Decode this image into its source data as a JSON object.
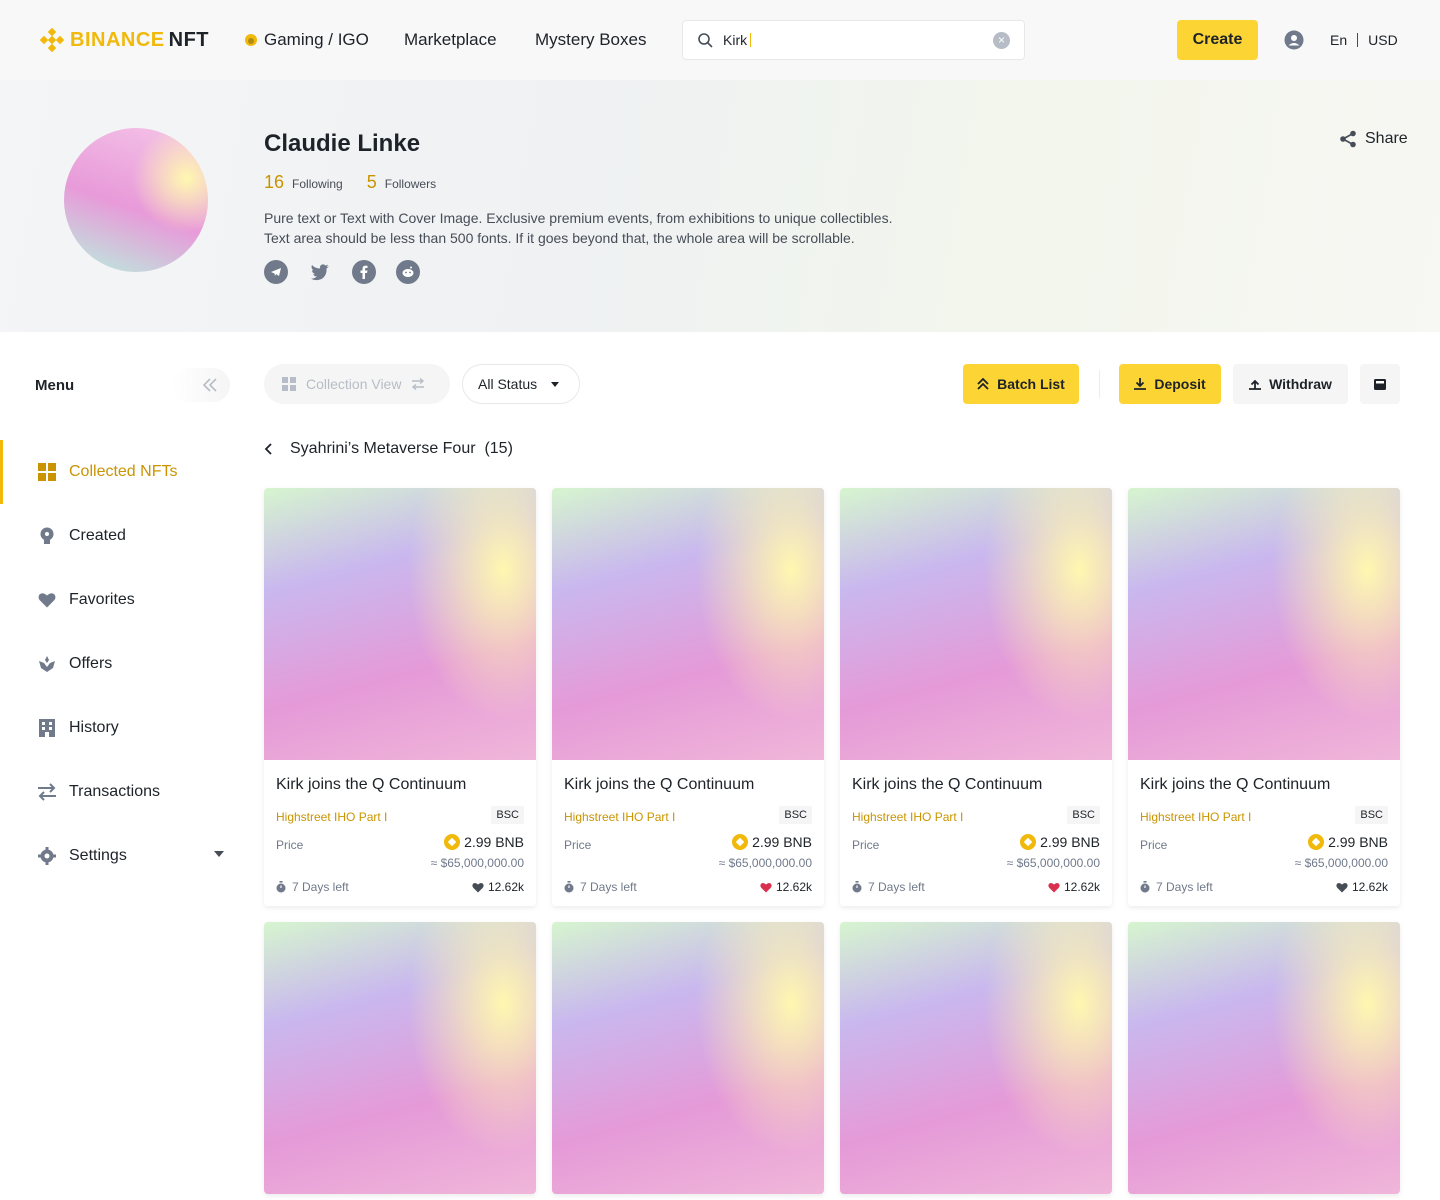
{
  "header": {
    "logo_main": "BINANCE",
    "logo_sub": "NFT",
    "nav": [
      "Gaming / IGO",
      "Marketplace",
      "Mystery Boxes"
    ],
    "search_value": "Kirk",
    "user_center": "User Center",
    "create_label": "Create",
    "language": "En",
    "currency": "USD"
  },
  "profile": {
    "name": "Claudie Linke",
    "following_count": "16",
    "following_label": "Following",
    "followers_count": "5",
    "followers_label": "Followers",
    "bio_line1": "Pure text or Text with Cover Image. Exclusive premium events, from exhibitions to unique collectibles.",
    "bio_line2": "Text area should be less than 500 fonts. If it goes beyond that, the whole area will be scrollable.",
    "share_label": "Share"
  },
  "sidebar": {
    "title": "Menu",
    "items": [
      {
        "label": "Collected NFTs",
        "icon": "grid-icon"
      },
      {
        "label": "Created",
        "icon": "bulb-icon"
      },
      {
        "label": "Favorites",
        "icon": "heart-icon"
      },
      {
        "label": "Offers",
        "icon": "hand-icon"
      },
      {
        "label": "History",
        "icon": "building-icon"
      },
      {
        "label": "Transactions",
        "icon": "swap-icon"
      },
      {
        "label": "Settings",
        "icon": "gear-icon"
      }
    ]
  },
  "toolbar": {
    "collection_view": "Collection View",
    "status": "All Status",
    "batch_list": "Batch List",
    "deposit": "Deposit",
    "withdraw": "Withdraw"
  },
  "breadcrumb": {
    "title": "Syahrini’s Metaverse Four",
    "count": "(15)"
  },
  "cards": [
    {
      "title": "Kirk joins the Q Continuum",
      "collection": "Highstreet IHO Part I",
      "chain": "BSC",
      "price_label": "Price",
      "price": "2.99 BNB",
      "usd": "≈ $65,000,000.00",
      "time_left": "7 Days left",
      "likes": "12.62k",
      "liked": false
    },
    {
      "title": "Kirk joins the Q Continuum",
      "collection": "Highstreet IHO Part I",
      "chain": "BSC",
      "price_label": "Price",
      "price": "2.99 BNB",
      "usd": "≈ $65,000,000.00",
      "time_left": "7 Days left",
      "likes": "12.62k",
      "liked": true
    },
    {
      "title": "Kirk joins the Q Continuum",
      "collection": "Highstreet IHO Part I",
      "chain": "BSC",
      "price_label": "Price",
      "price": "2.99 BNB",
      "usd": "≈ $65,000,000.00",
      "time_left": "7 Days left",
      "likes": "12.62k",
      "liked": true
    },
    {
      "title": "Kirk joins the Q Continuum",
      "collection": "Highstreet IHO Part I",
      "chain": "BSC",
      "price_label": "Price",
      "price": "2.99 BNB",
      "usd": "≈ $65,000,000.00",
      "time_left": "7 Days left",
      "likes": "12.62k",
      "liked": false
    }
  ],
  "colors": {
    "brand": "#F0B90B",
    "button_yellow": "#FCD535",
    "like_red": "#D9304E"
  }
}
